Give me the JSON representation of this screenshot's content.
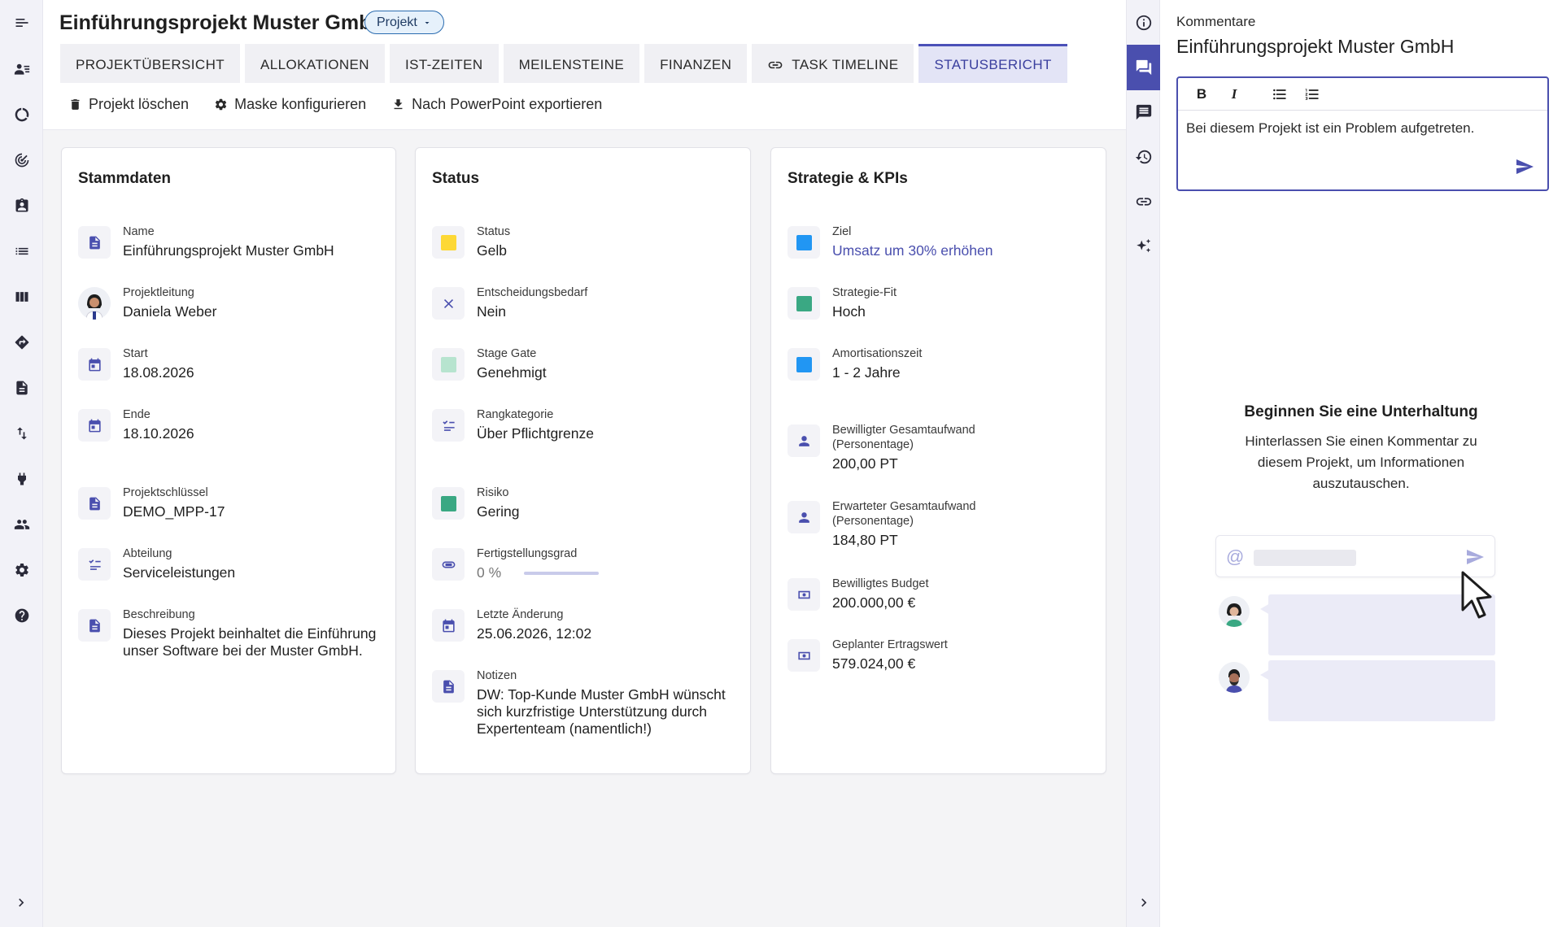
{
  "left_rail": {
    "items": [
      {
        "icon": "menu-toggle-icon"
      },
      {
        "icon": "people-list-icon"
      },
      {
        "icon": "donut-chart-icon"
      },
      {
        "icon": "target-icon"
      },
      {
        "icon": "assignment-icon"
      },
      {
        "icon": "list-icon"
      },
      {
        "icon": "board-columns-icon"
      },
      {
        "icon": "directions-icon"
      },
      {
        "icon": "document-icon"
      },
      {
        "icon": "swap-vertical-icon"
      },
      {
        "icon": "plug-icon"
      },
      {
        "icon": "group-icon"
      },
      {
        "icon": "settings-icon"
      },
      {
        "icon": "help-icon"
      }
    ],
    "expand_icon": "chevron-right-icon"
  },
  "header": {
    "title": "Einführungsprojekt Muster GmbH",
    "type_chip": "Projekt"
  },
  "tabs": [
    {
      "label": "PROJEKTÜBERSICHT",
      "active": false
    },
    {
      "label": "ALLOKATIONEN",
      "active": false
    },
    {
      "label": "IST-ZEITEN",
      "active": false
    },
    {
      "label": "MEILENSTEINE",
      "active": false
    },
    {
      "label": "FINANZEN",
      "active": false
    },
    {
      "label": "TASK TIMELINE",
      "active": false,
      "icon": "link-icon"
    },
    {
      "label": "STATUSBERICHT",
      "active": true
    }
  ],
  "actions": [
    {
      "label": "Projekt löschen",
      "icon": "trash-icon"
    },
    {
      "label": "Maske konfigurieren",
      "icon": "gear-icon"
    },
    {
      "label": "Nach PowerPoint exportieren",
      "icon": "download-icon"
    }
  ],
  "stammdaten": {
    "title": "Stammdaten",
    "fields": [
      {
        "label": "Name",
        "value": "Einführungsprojekt Muster GmbH"
      },
      {
        "label": "Projektleitung",
        "value": "Daniela Weber"
      },
      {
        "label": "Start",
        "value": "18.08.2026"
      },
      {
        "label": "Ende",
        "value": "18.10.2026"
      },
      {
        "label": "Projektschlüssel",
        "value": "DEMO_MPP-17"
      },
      {
        "label": "Abteilung",
        "value": "Serviceleistungen"
      },
      {
        "label": "Beschreibung",
        "value": "Dieses Projekt beinhaltet die Einführung unser Software bei der Muster GmbH."
      }
    ]
  },
  "status": {
    "title": "Status",
    "fields": [
      {
        "label": "Status",
        "value": "Gelb",
        "color": "#fdd835"
      },
      {
        "label": "Entscheidungsbedarf",
        "value": "Nein"
      },
      {
        "label": "Stage Gate",
        "value": "Genehmigt",
        "color": "#b7e4cf"
      },
      {
        "label": "Rangkategorie",
        "value": "Über Pflichtgrenze"
      },
      {
        "label": "Risiko",
        "value": "Gering",
        "color": "#3aa883"
      },
      {
        "label": "Fertigstellungsgrad",
        "value": "0 %",
        "progress": 0
      },
      {
        "label": "Letzte Änderung",
        "value": "25.06.2026, 12:02"
      },
      {
        "label": "Notizen",
        "value": "DW: Top-Kunde Muster GmbH wünscht sich kurzfristige Unterstützung durch Expertenteam (namentlich!)"
      }
    ]
  },
  "strategie": {
    "title": "Strategie & KPIs",
    "fields": [
      {
        "label": "Ziel",
        "value": "Umsatz um 30% erhöhen",
        "color": "#2196f3"
      },
      {
        "label": "Strategie-Fit",
        "value": "Hoch",
        "color": "#3aa883"
      },
      {
        "label": "Amortisationszeit",
        "value": "1 - 2 Jahre",
        "color": "#2196f3"
      },
      {
        "label": "Bewilligter Gesamtaufwand (Personentage)",
        "value": "200,00 PT"
      },
      {
        "label": "Erwarteter Gesamtaufwand (Personentage)",
        "value": "184,80 PT"
      },
      {
        "label": "Bewilligtes Budget",
        "value": "200.000,00 €"
      },
      {
        "label": "Geplanter Ertragswert",
        "value": "579.024,00 €"
      }
    ]
  },
  "right_rail": {
    "items": [
      {
        "icon": "info-icon"
      },
      {
        "icon": "forum-icon",
        "active": true
      },
      {
        "icon": "comment-icon"
      },
      {
        "icon": "history-icon"
      },
      {
        "icon": "link-icon"
      },
      {
        "icon": "sparkle-icon"
      }
    ],
    "expand_icon": "chevron-right-icon"
  },
  "comments": {
    "label": "Kommentare",
    "title": "Einführungsprojekt Muster GmbH",
    "editor_text": "Bei diesem Projekt ist ein Problem aufgetreten.",
    "toolbar": {
      "bold": "B",
      "italic": "I"
    },
    "empty_title": "Beginnen Sie eine Unterhaltung",
    "empty_description": "Hinterlassen Sie einen Kommentar zu diesem Projekt, um Informationen auszutauschen.",
    "illustration_at": "@"
  },
  "colors": {
    "accent": "#4a4fae",
    "rail_bg": "#f2f2f8"
  }
}
